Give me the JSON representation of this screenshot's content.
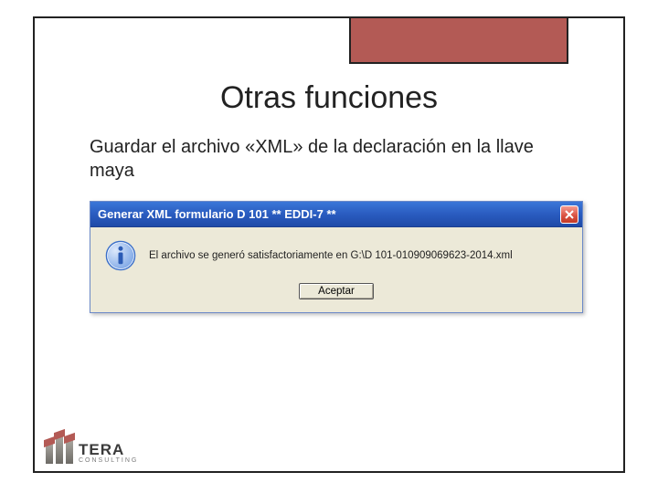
{
  "slide": {
    "title": "Otras funciones",
    "body": "Guardar el archivo «XML» de la declaración en la llave maya"
  },
  "dialog": {
    "title": "Generar XML formulario D 101 ** EDDI-7 **",
    "message": "El archivo se generó satisfactoriamente en G:\\D 101-010909069623-2014.xml",
    "ok_label": "Aceptar"
  },
  "logo": {
    "name": "TERA",
    "sub": "Consulting"
  }
}
